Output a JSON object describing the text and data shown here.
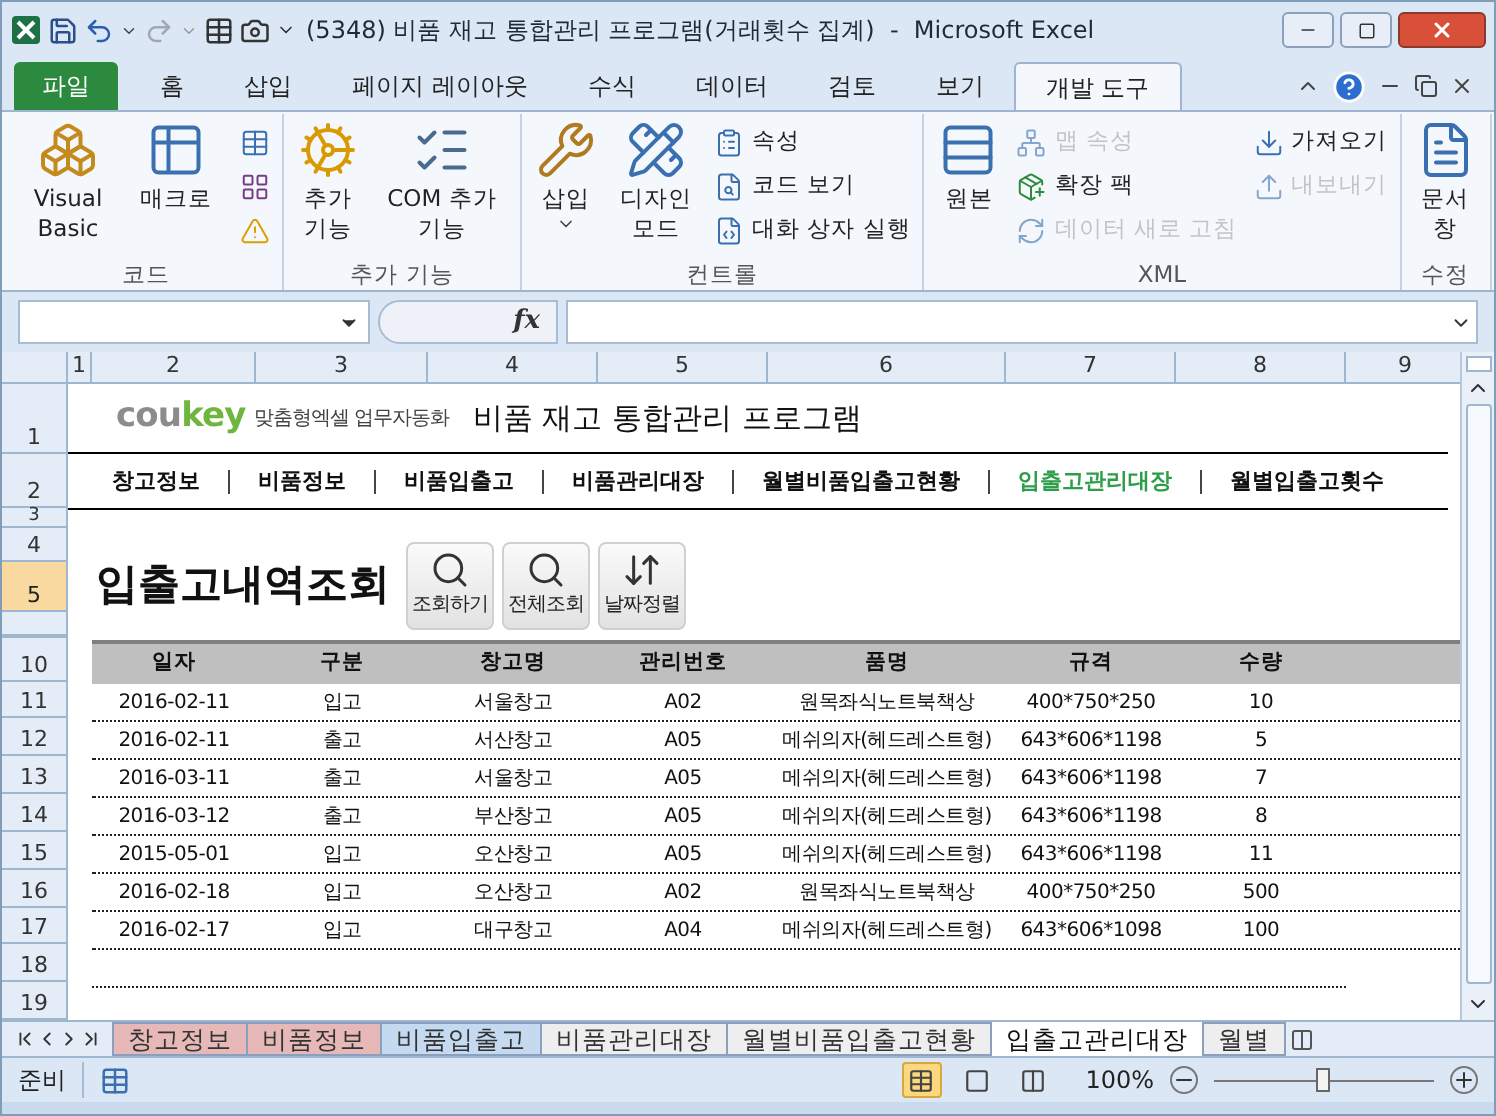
{
  "window": {
    "title": "(5348) 비품 재고 통합관리 프로그램(거래횟수 집계)  -  Microsoft Excel"
  },
  "ribbon_tabs": [
    {
      "label": "파일",
      "kind": "file",
      "selected": false
    },
    {
      "label": "홈",
      "kind": "tab",
      "selected": false
    },
    {
      "label": "삽입",
      "kind": "tab",
      "selected": false
    },
    {
      "label": "페이지 레이아웃",
      "kind": "tab",
      "selected": false
    },
    {
      "label": "수식",
      "kind": "tab",
      "selected": false
    },
    {
      "label": "데이터",
      "kind": "tab",
      "selected": false
    },
    {
      "label": "검토",
      "kind": "tab",
      "selected": false
    },
    {
      "label": "보기",
      "kind": "tab",
      "selected": false
    },
    {
      "label": "개발 도구",
      "kind": "tab",
      "selected": true
    }
  ],
  "ribbon_groups": [
    {
      "label": "코드",
      "items": [
        {
          "kind": "large",
          "label": "Visual Basic",
          "disabled": false
        },
        {
          "kind": "large",
          "label": "매크로",
          "disabled": false
        },
        {
          "kind": "icon",
          "disabled": false
        },
        {
          "kind": "icon",
          "disabled": false
        },
        {
          "kind": "icon",
          "disabled": false
        }
      ]
    },
    {
      "label": "추가 기능",
      "items": [
        {
          "kind": "large",
          "label": "추가 기능",
          "disabled": false
        },
        {
          "kind": "large",
          "label": "COM 추가 기능",
          "disabled": false
        }
      ]
    },
    {
      "label": "컨트롤",
      "items": [
        {
          "kind": "split",
          "label": "삽입",
          "disabled": false
        },
        {
          "kind": "large",
          "label": "디자인 모드",
          "disabled": false
        },
        {
          "kind": "small",
          "label": "속성",
          "disabled": false
        },
        {
          "kind": "small",
          "label": "코드 보기",
          "disabled": false
        },
        {
          "kind": "small",
          "label": "대화 상자 실행",
          "disabled": false
        }
      ]
    },
    {
      "label": "XML",
      "items": [
        {
          "kind": "large",
          "label": "원본",
          "disabled": false
        },
        {
          "kind": "small",
          "label": "맵 속성",
          "disabled": true
        },
        {
          "kind": "small",
          "label": "확장 팩",
          "disabled": false
        },
        {
          "kind": "small",
          "label": "데이터 새로 고침",
          "disabled": true
        },
        {
          "kind": "small",
          "label": "가져오기",
          "disabled": false
        },
        {
          "kind": "small",
          "label": "내보내기",
          "disabled": true
        }
      ]
    },
    {
      "label": "수정",
      "items": [
        {
          "kind": "large",
          "label": "문서 창",
          "disabled": false
        }
      ]
    }
  ],
  "formula_bar": {
    "function_label": "fx"
  },
  "column_headers": [
    "1",
    "2",
    "3",
    "4",
    "5",
    "6",
    "7",
    "8",
    "9"
  ],
  "row_headers": [
    {
      "label": "1",
      "selected": false
    },
    {
      "label": "2",
      "selected": false
    },
    {
      "label": "3",
      "selected": false
    },
    {
      "label": "4",
      "selected": false
    },
    {
      "label": "5",
      "selected": true
    },
    {
      "label": "10",
      "selected": false
    },
    {
      "label": "11",
      "selected": false
    },
    {
      "label": "12",
      "selected": false
    },
    {
      "label": "13",
      "selected": false
    },
    {
      "label": "14",
      "selected": false
    },
    {
      "label": "15",
      "selected": false
    },
    {
      "label": "16",
      "selected": false
    },
    {
      "label": "17",
      "selected": false
    },
    {
      "label": "18",
      "selected": false
    },
    {
      "label": "19",
      "selected": false
    }
  ],
  "sheet": {
    "logo": [
      "cou",
      "key"
    ],
    "tagline": "맞춤형엑셀 업무자동화",
    "title": "비품 재고 통합관리 프로그램",
    "nav": [
      {
        "label": "창고정보",
        "selected": false
      },
      {
        "label": "비품정보",
        "selected": false
      },
      {
        "label": "비품입출고",
        "selected": false
      },
      {
        "label": "비품관리대장",
        "selected": false
      },
      {
        "label": "월별비품입출고현황",
        "selected": false
      },
      {
        "label": "입출고관리대장",
        "selected": true
      },
      {
        "label": "월별입출고횟수",
        "selected": false
      }
    ],
    "section_title": "입출고내역조회",
    "buttons": [
      {
        "label": "조회하기",
        "kind": "search"
      },
      {
        "label": "전체조회",
        "kind": "search"
      },
      {
        "label": "날짜정렬",
        "kind": "sort"
      }
    ],
    "table": {
      "columns": [
        "일자",
        "구분",
        "창고명",
        "관리번호",
        "품명",
        "규격",
        "수량"
      ],
      "rows": [
        [
          "2016-02-11",
          "입고",
          "서울창고",
          "A02",
          "원목좌식노트북책상",
          "400*750*250",
          "10"
        ],
        [
          "2016-02-11",
          "출고",
          "서산창고",
          "A05",
          "메쉬의자(헤드레스트형)",
          "643*606*1198",
          "5"
        ],
        [
          "2016-03-11",
          "출고",
          "서울창고",
          "A05",
          "메쉬의자(헤드레스트형)",
          "643*606*1198",
          "7"
        ],
        [
          "2016-03-12",
          "출고",
          "부산창고",
          "A05",
          "메쉬의자(헤드레스트형)",
          "643*606*1198",
          "8"
        ],
        [
          "2015-05-01",
          "입고",
          "오산창고",
          "A05",
          "메쉬의자(헤드레스트형)",
          "643*606*1198",
          "11"
        ],
        [
          "2016-02-18",
          "입고",
          "오산창고",
          "A02",
          "원목좌식노트북책상",
          "400*750*250",
          "500"
        ],
        [
          "2016-02-17",
          "입고",
          "대구창고",
          "A04",
          "메쉬의자(헤드레스트형)",
          "643*606*1098",
          "100"
        ]
      ]
    }
  },
  "sheet_tabs": [
    {
      "label": "창고정보",
      "selected": false,
      "color": "#e6b8b7"
    },
    {
      "label": "비품정보",
      "selected": false,
      "color": "#e6b8b7"
    },
    {
      "label": "비품입출고",
      "selected": false,
      "color": "#c5d9f1"
    },
    {
      "label": "비품관리대장",
      "selected": false,
      "color": "#eeeeee"
    },
    {
      "label": "월별비품입출고현황",
      "selected": false,
      "color": "#eeeeee"
    },
    {
      "label": "입출고관리대장",
      "selected": true,
      "color": "#ffffff"
    },
    {
      "label": "월별",
      "selected": false,
      "color": "#eeeeee"
    }
  ],
  "status_bar": {
    "status": "준비",
    "views": [
      {
        "selected": true
      },
      {
        "selected": false
      },
      {
        "selected": false
      }
    ],
    "zoom": {
      "label": "100%",
      "level": 0.5
    }
  }
}
